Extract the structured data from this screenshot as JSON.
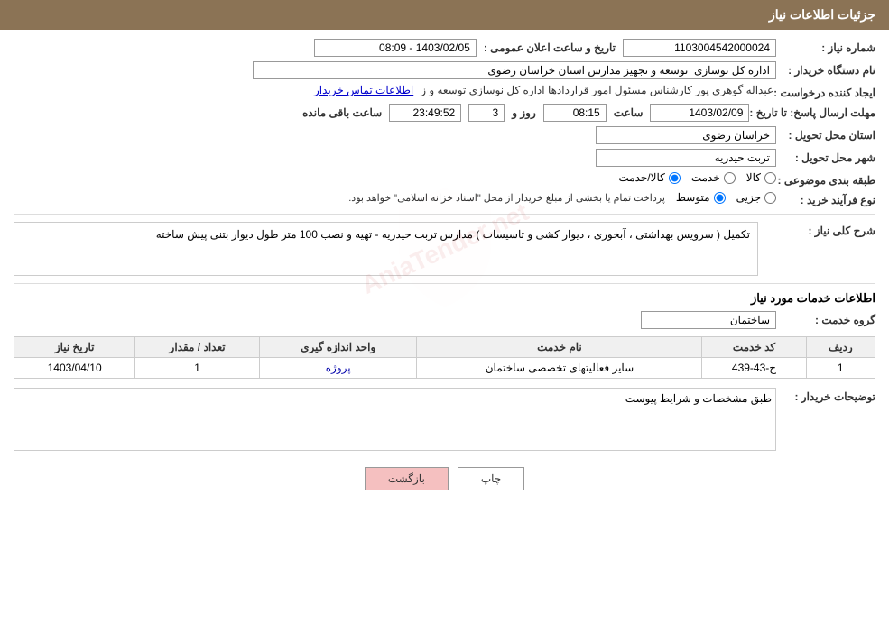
{
  "header": {
    "title": "جزئیات اطلاعات نیاز"
  },
  "fields": {
    "need_number_label": "شماره نیاز :",
    "need_number_value": "1103004542000024",
    "announce_datetime_label": "تاریخ و ساعت اعلان عمومی :",
    "announce_datetime_value": "1403/02/05 - 08:09",
    "buyer_name_label": "نام دستگاه خریدار :",
    "buyer_name_value": "اداره کل نوسازی  توسعه و تجهیز مدارس استان خراسان رضوی",
    "creator_label": "ایجاد کننده درخواست :",
    "creator_value": "عبداله گوهری پور کارشناس مسئول امور قراردادها  اداره کل نوسازی  توسعه و ز",
    "creator_link": "اطلاعات تماس خریدار",
    "response_deadline_label": "مهلت ارسال پاسخ: تا تاریخ :",
    "response_date_value": "1403/02/09",
    "response_time_label": "ساعت",
    "response_time_value": "08:15",
    "response_day_label": "روز و",
    "response_days_value": "3",
    "response_remaining_label": "ساعت باقی مانده",
    "response_remaining_value": "23:49:52",
    "province_label": "استان محل تحویل :",
    "province_value": "خراسان رضوی",
    "city_label": "شهر محل تحویل :",
    "city_value": "تربت حیدریه",
    "category_label": "طبقه بندی موضوعی :",
    "category_kala": "کالا",
    "category_khadamat": "خدمت",
    "category_kala_khadamat": "کالا/خدمت",
    "category_selected": "کالا/خدمت",
    "purchase_type_label": "نوع فرآیند خرید :",
    "purchase_type_jazee": "جزیی",
    "purchase_type_motavaset": "متوسط",
    "purchase_type_note": "پرداخت تمام یا بخشی از مبلغ خریدار از محل \"اسناد خزانه اسلامی\" خواهد بود.",
    "purchase_type_selected": "متوسط",
    "description_label": "شرح کلی نیاز :",
    "description_value": "تکمیل ( سرویس بهداشتی ، آبخوری ، دیوار کشی و تاسیسات ) مدارس تربت حیدریه - تهیه و نصب 100 متر طول دیوار بتنی پیش ساخته",
    "services_section_label": "اطلاعات خدمات مورد نیاز",
    "service_group_label": "گروه خدمت :",
    "service_group_value": "ساختمان",
    "table_headers": {
      "row_num": "ردیف",
      "service_code": "کد خدمت",
      "service_name": "نام خدمت",
      "unit": "واحد اندازه گیری",
      "quantity": "تعداد / مقدار",
      "date": "تاریخ نیاز"
    },
    "table_rows": [
      {
        "row_num": "1",
        "service_code": "ج-43-439",
        "service_name": "سایر فعالیتهای تخصصی ساختمان",
        "unit": "پروژه",
        "quantity": "1",
        "date": "1403/04/10"
      }
    ],
    "buyer_notes_label": "توضیحات خریدار :",
    "buyer_notes_value": "طبق مشخصات و شرایط پیوست",
    "btn_print": "چاپ",
    "btn_back": "بازگشت"
  }
}
